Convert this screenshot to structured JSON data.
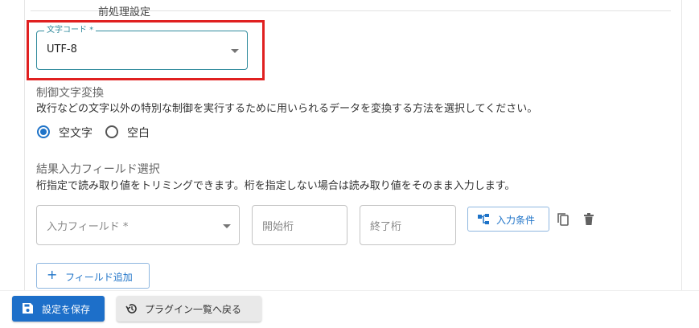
{
  "section": {
    "title": "前処理設定"
  },
  "encoding": {
    "label": "文字コード *",
    "value": "UTF-8"
  },
  "control_chars": {
    "label": "制御文字変換",
    "description": "改行などの文字以外の特別な制御を実行するために用いられるデータを変換する方法を選択してください。",
    "options": [
      {
        "label": "空文字",
        "selected": true
      },
      {
        "label": "空白",
        "selected": false
      }
    ]
  },
  "result_fields": {
    "label": "結果入力フィールド選択",
    "description": "桁指定で読み取り値をトリミングできます。桁を指定しない場合は読み取り値をそのまま入力します。",
    "field_placeholder": "入力フィールド *",
    "start_placeholder": "開始桁",
    "end_placeholder": "終了桁",
    "condition_button": "入力条件",
    "add_field_button": "フィールド追加"
  },
  "footer": {
    "save_button": "設定を保存",
    "back_button": "プラグイン一覧へ戻る"
  },
  "colors": {
    "accent": "#1d6fc9",
    "highlight": "#e02020",
    "focus": "#2f8a9c"
  }
}
